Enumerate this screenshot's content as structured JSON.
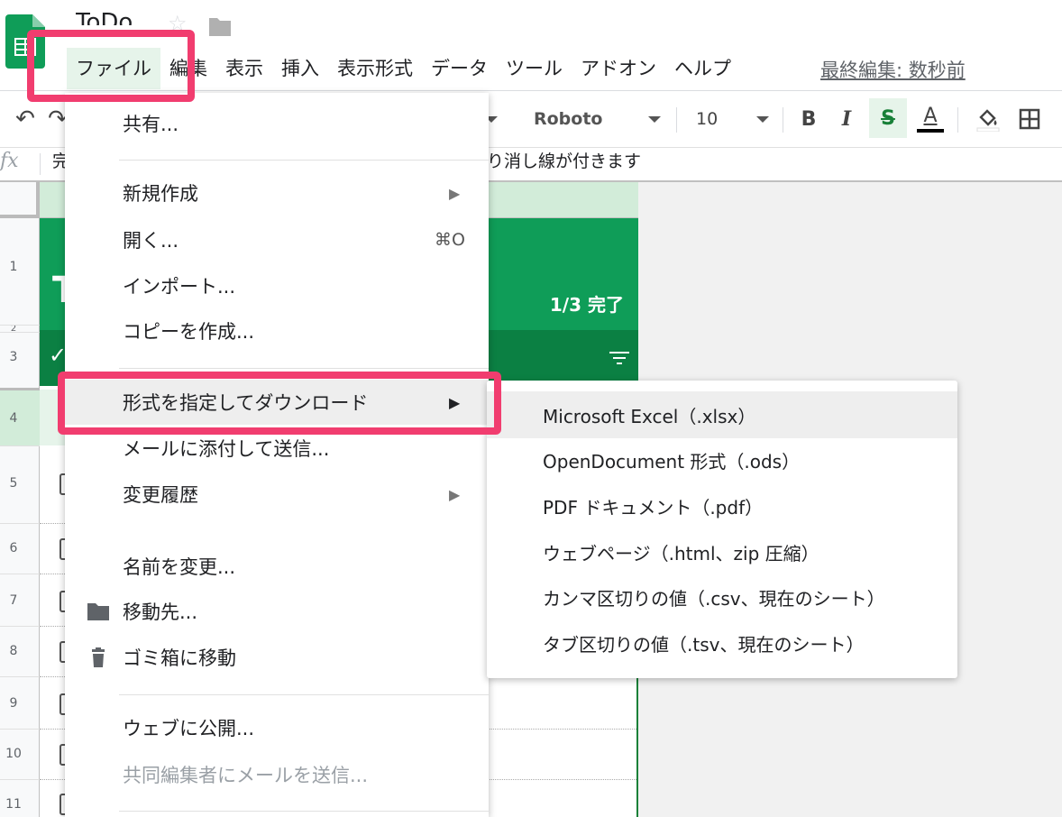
{
  "header": {
    "doc_title": "ToDo",
    "last_edit": "最終編集: 数秒前"
  },
  "menubar": [
    {
      "label": "ファイル"
    },
    {
      "label": "編集"
    },
    {
      "label": "表示"
    },
    {
      "label": "挿入"
    },
    {
      "label": "表示形式"
    },
    {
      "label": "データ"
    },
    {
      "label": "ツール"
    },
    {
      "label": "アドオン"
    },
    {
      "label": "ヘルプ"
    }
  ],
  "toolbar": {
    "font": "Roboto",
    "font_size": "10",
    "bold": "B",
    "italic": "I",
    "strike": "S",
    "text_color": "A"
  },
  "formula_bar": {
    "fx": "fx",
    "content_left": "完",
    "content_right": "り消し線が付きます"
  },
  "sheet": {
    "row_numbers": [
      "1",
      "2",
      "3",
      "4",
      "5",
      "6",
      "7",
      "8",
      "9",
      "10",
      "11"
    ],
    "header_title": "T",
    "progress": "1/3 完了",
    "check": "✓"
  },
  "file_menu": {
    "share": "共有...",
    "new": "新規作成",
    "open": "開く...",
    "open_shortcut": "⌘O",
    "import": "インポート...",
    "make_copy": "コピーを作成...",
    "download_as": "形式を指定してダウンロード",
    "email_attachment": "メールに添付して送信...",
    "version_history": "変更履歴",
    "rename": "名前を変更...",
    "move_to": "移動先...",
    "trash": "ゴミ箱に移動",
    "publish": "ウェブに公開...",
    "email_collaborators": "共同編集者にメールを送信..."
  },
  "download_submenu": [
    {
      "label": "Microsoft Excel（.xlsx）"
    },
    {
      "label": "OpenDocument 形式（.ods）"
    },
    {
      "label": "PDF ドキュメント（.pdf）"
    },
    {
      "label": "ウェブページ（.html、zip 圧縮）"
    },
    {
      "label": "カンマ区切りの値（.csv、現在のシート）"
    },
    {
      "label": "タブ区切りの値（.tsv、現在のシート）"
    }
  ],
  "colors": {
    "highlight": "#f13d6f",
    "sheets_green": "#0f9d58",
    "dark_green": "#0b8043",
    "light_green": "#e6f4ea"
  }
}
